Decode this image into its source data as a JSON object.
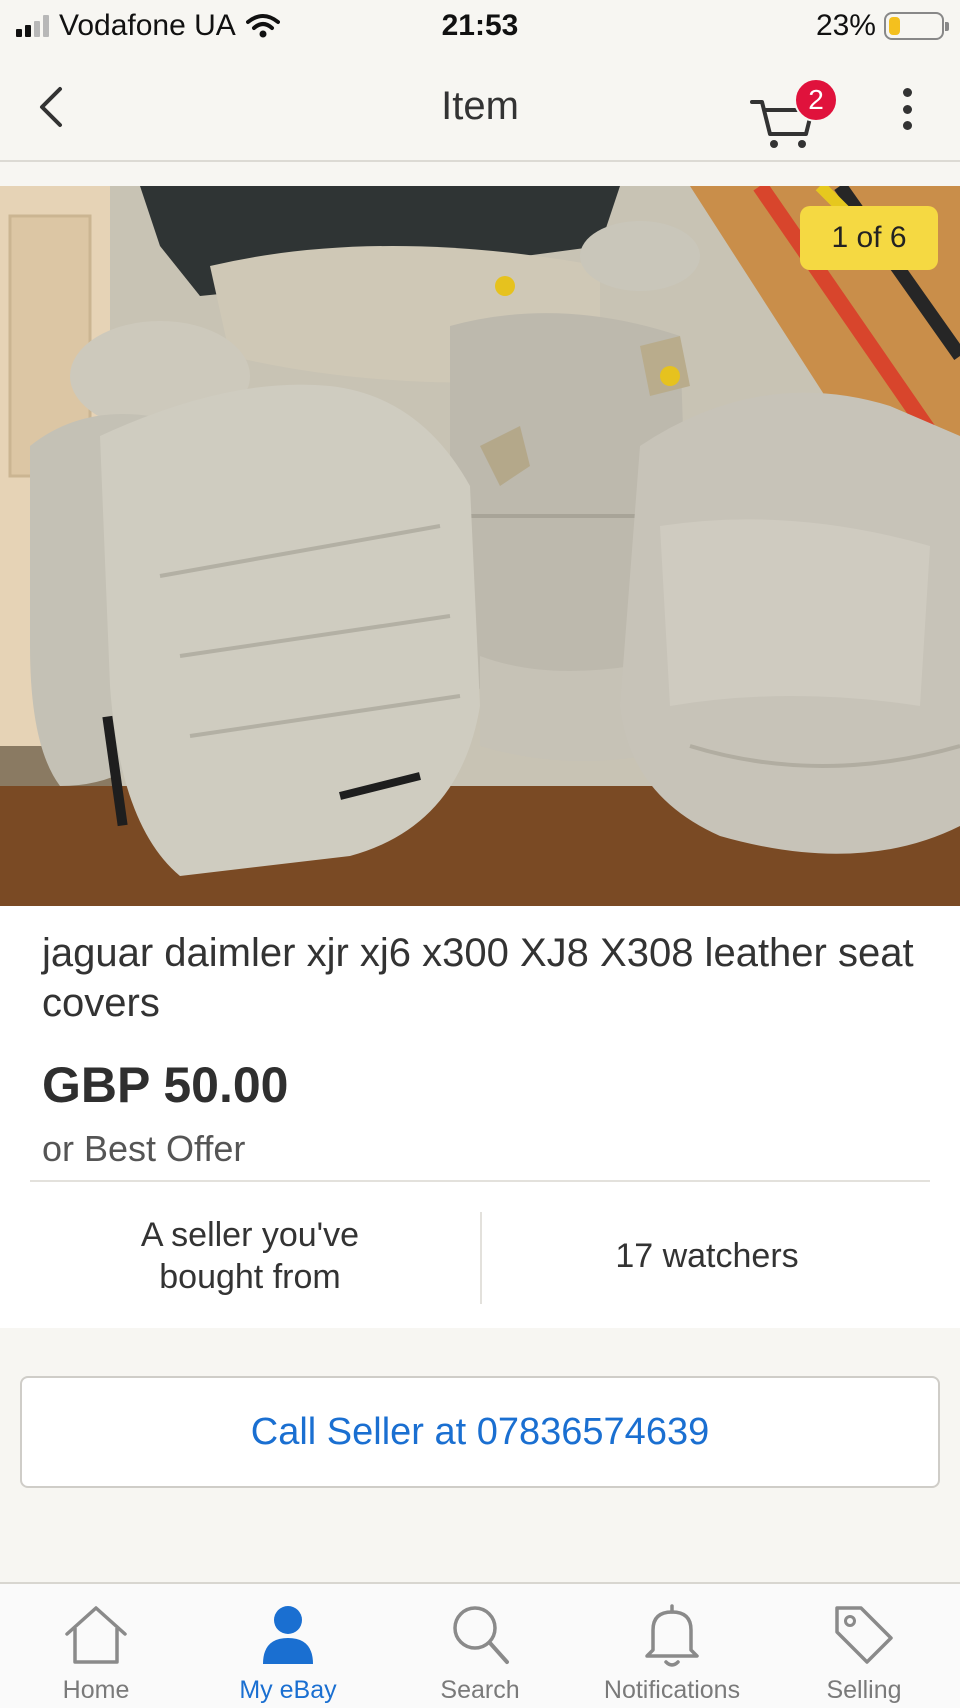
{
  "status_bar": {
    "carrier": "Vodafone UA",
    "time": "21:53",
    "battery_percent": "23%",
    "battery_level": 0.23
  },
  "nav": {
    "title": "Item",
    "cart_count": "2",
    "icons": [
      "chevron-left-icon",
      "cart-icon",
      "more-vertical-icon"
    ]
  },
  "gallery": {
    "counter": "1 of 6"
  },
  "item": {
    "title": "jaguar daimler xjr xj6 x300 XJ8 X308 leather seat covers",
    "price": "GBP 50.00",
    "offer_text": "or Best Offer",
    "seller_note": "A seller you've bought from",
    "watchers": "17 watchers"
  },
  "actions": {
    "call_seller": "Call Seller at 07836574639"
  },
  "tabs": [
    {
      "label": "Home",
      "icon": "home-icon",
      "active": false
    },
    {
      "label": "My eBay",
      "icon": "person-icon",
      "active": true
    },
    {
      "label": "Search",
      "icon": "search-icon",
      "active": false
    },
    {
      "label": "Notifications",
      "icon": "bell-icon",
      "active": false
    },
    {
      "label": "Selling",
      "icon": "tag-icon",
      "active": false
    }
  ],
  "colors": {
    "accent": "#1a6fd1",
    "badge": "#e0123c",
    "counter_bg": "#f5d942",
    "battery": "#f4c01e"
  }
}
